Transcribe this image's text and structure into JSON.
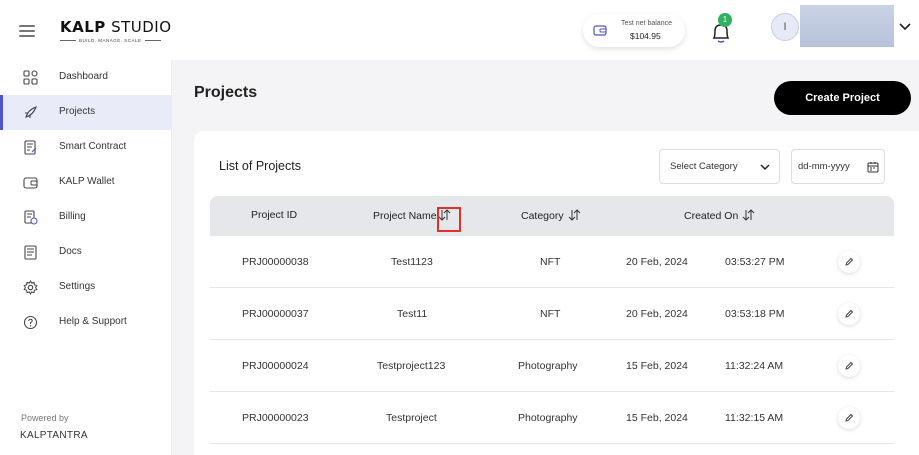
{
  "header": {
    "logo_bold": "KALP",
    "logo_rest": " STUDIO",
    "logo_tagline": "BUILD. MANAGE. SCALE",
    "balance_label": "Test net balance",
    "balance_value": "$104.95",
    "notification_count": "1",
    "avatar_initial": "I"
  },
  "sidebar": {
    "items": [
      {
        "label": "Dashboard",
        "icon": "dashboard-icon"
      },
      {
        "label": "Projects",
        "icon": "rocket-icon",
        "active": true
      },
      {
        "label": "Smart Contract",
        "icon": "contract-icon"
      },
      {
        "label": "KALP Wallet",
        "icon": "wallet-icon"
      },
      {
        "label": "Billing",
        "icon": "billing-icon"
      },
      {
        "label": "Docs",
        "icon": "docs-icon"
      },
      {
        "label": "Settings",
        "icon": "gear-icon"
      },
      {
        "label": "Help & Support",
        "icon": "help-icon"
      }
    ],
    "powered_by": "Powered by",
    "company": "KALPTANTRA"
  },
  "main": {
    "title": "Projects",
    "create_button": "Create Project",
    "list_title": "List of Projects",
    "category_select": "Select Category",
    "date_placeholder": "dd-mm-yyyy",
    "columns": [
      "Project ID",
      "Project Name",
      "Category",
      "Created On"
    ],
    "rows": [
      {
        "id": "PRJ00000038",
        "name": "Test1123",
        "category": "NFT",
        "date": "20 Feb, 2024",
        "time": "03:53:27 PM"
      },
      {
        "id": "PRJ00000037",
        "name": "Test11",
        "category": "NFT",
        "date": "20 Feb, 2024",
        "time": "03:53:18 PM"
      },
      {
        "id": "PRJ00000024",
        "name": "Testproject123",
        "category": "Photography",
        "date": "15 Feb, 2024",
        "time": "11:32:24 AM"
      },
      {
        "id": "PRJ00000023",
        "name": "Testproject",
        "category": "Photography",
        "date": "15 Feb, 2024",
        "time": "11:32:15 AM"
      }
    ]
  },
  "colors": {
    "accent": "#4b57c6",
    "active_bg": "#e9ebf8",
    "badge": "#2eb360",
    "highlight": "#e0302a"
  }
}
